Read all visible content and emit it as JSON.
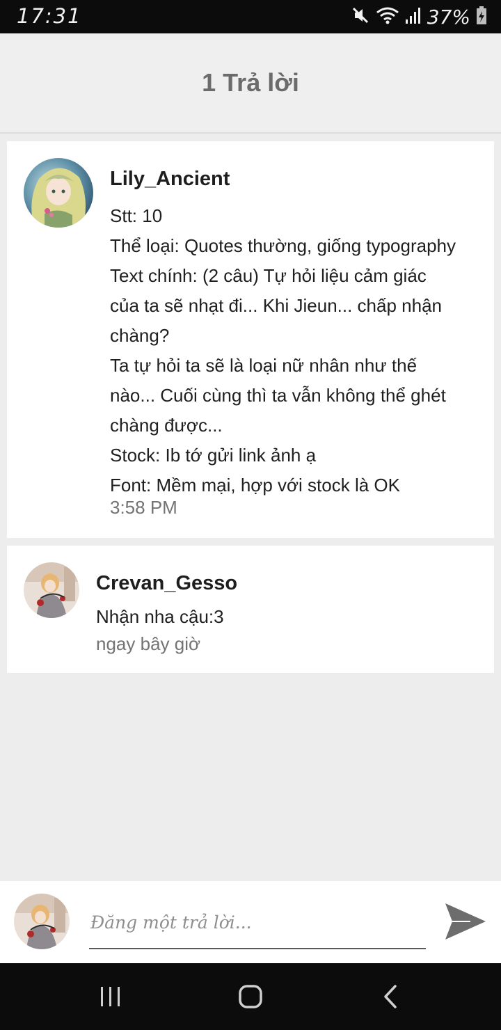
{
  "status_bar": {
    "time": "17:31",
    "battery_text": "37%",
    "icons": [
      "mute-icon",
      "wifi-icon",
      "signal-icon",
      "battery-icon"
    ]
  },
  "header": {
    "title": "1 Trả lời"
  },
  "post": {
    "author": "Lily_Ancient",
    "lines": [
      "Stt: 10",
      "Thể loại: Quotes thường, giống typography",
      "Text chính: (2 câu) Tự hỏi liệu cảm giác",
      "của ta sẽ nhạt đi... Khi Jieun... chấp nhận",
      "chàng?",
      "Ta tự hỏi ta sẽ là loại nữ nhân như thế",
      "nào... Cuối cùng thì ta vẫn không thể ghét",
      "chàng được...",
      "Stock: Ib tớ gửi link ảnh ạ",
      "Font: Mềm mại, hợp với stock là OK"
    ],
    "time": "3:58 PM"
  },
  "reply": {
    "author": "Crevan_Gesso",
    "text": "Nhận nha cậu:3",
    "time": "ngay bây giờ"
  },
  "composer": {
    "placeholder": "Đăng một trả lời...",
    "value": ""
  },
  "nav": {
    "icons": [
      "recents-icon",
      "home-icon",
      "back-icon"
    ]
  },
  "colors": {
    "background": "#ededed",
    "header_bg": "#efefef",
    "card_bg": "#ffffff",
    "title_text": "#6b6b6b",
    "timestamp_text": "#737373",
    "system_bars": "#0c0c0c",
    "send_icon": "#6d6d6d"
  }
}
